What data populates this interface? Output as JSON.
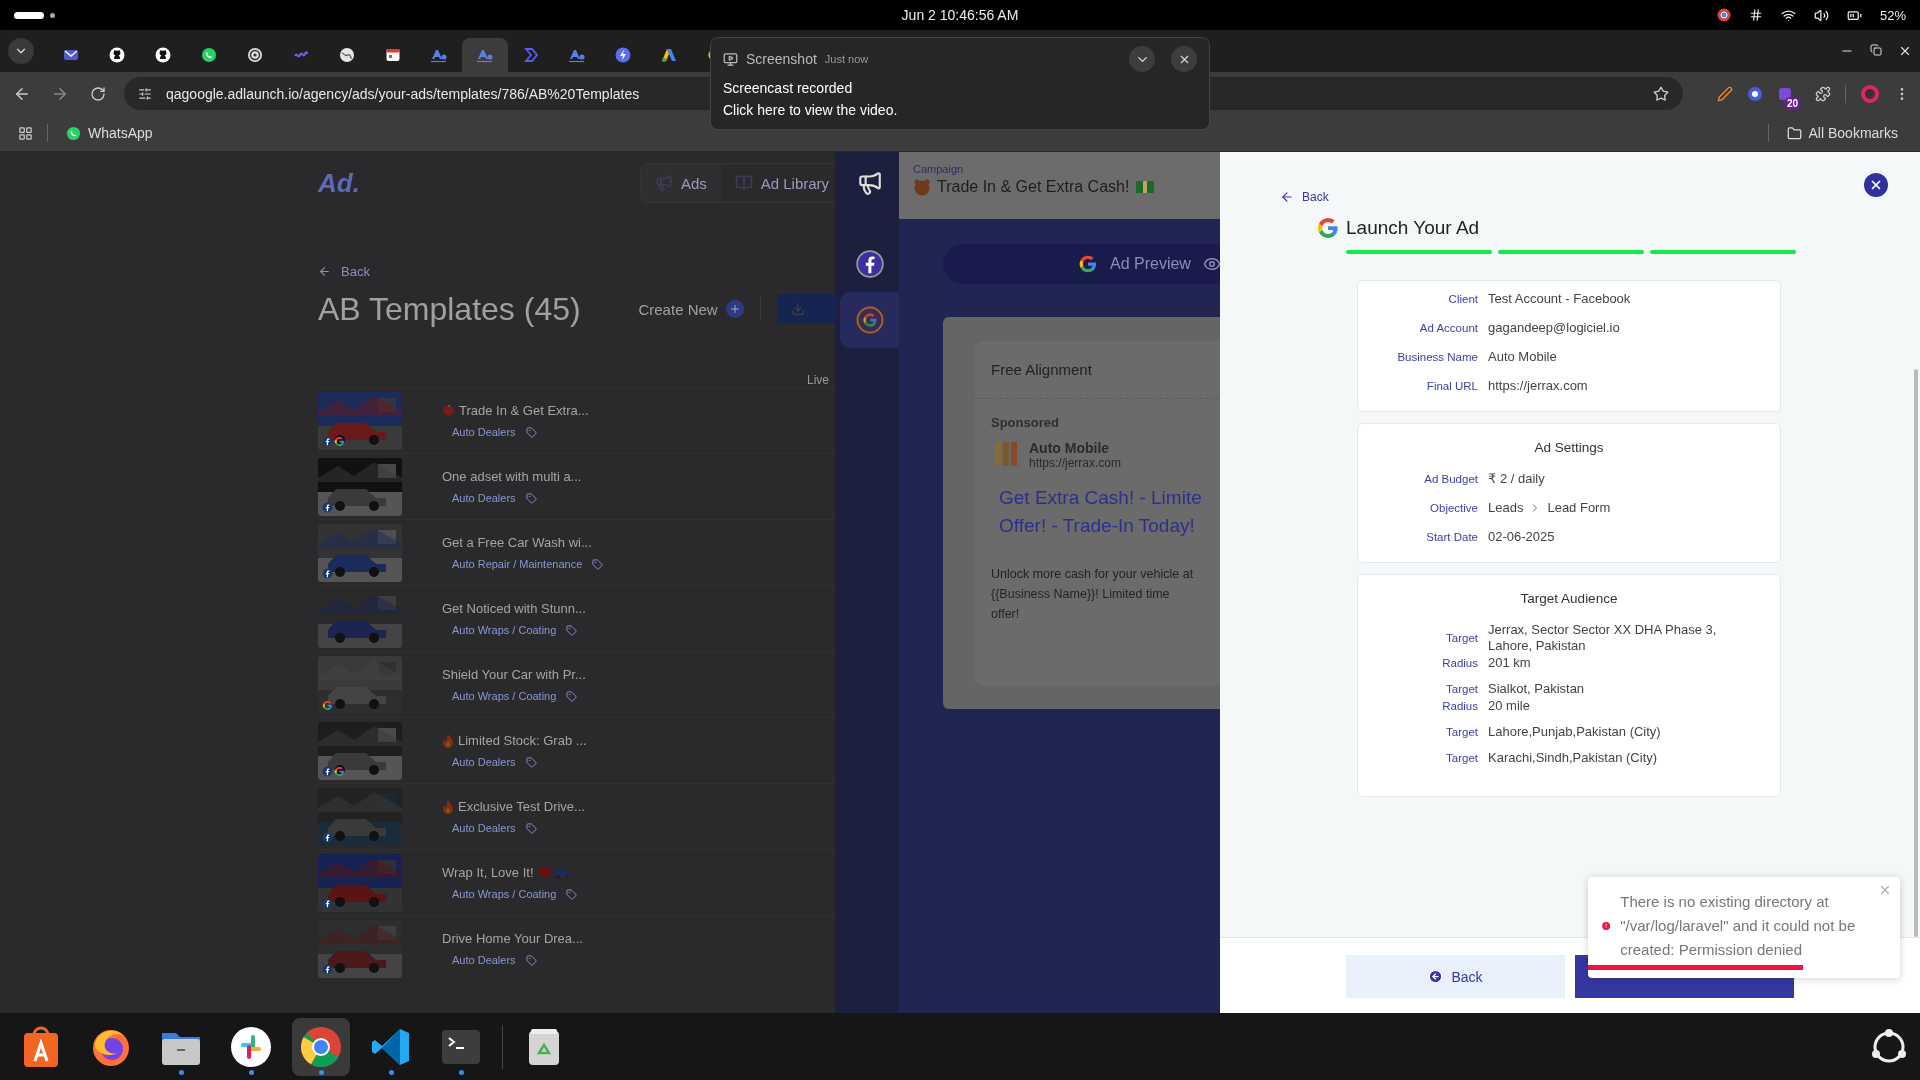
{
  "system_bar": {
    "date_time": "Jun 2  10:46:56 AM",
    "battery": "52%"
  },
  "browser": {
    "tabs": [
      {
        "kind": "mail",
        "selected": false
      },
      {
        "kind": "github",
        "selected": false
      },
      {
        "kind": "github",
        "selected": false
      },
      {
        "kind": "chat",
        "selected": false
      },
      {
        "kind": "ring",
        "selected": false
      },
      {
        "kind": "pen",
        "selected": false
      },
      {
        "kind": "globe",
        "selected": false
      },
      {
        "kind": "calendar",
        "selected": false
      },
      {
        "kind": "ad",
        "selected": false
      },
      {
        "kind": "ad",
        "selected": true
      },
      {
        "kind": "chevron",
        "selected": false
      },
      {
        "kind": "ad",
        "selected": false
      },
      {
        "kind": "bolt",
        "selected": false
      },
      {
        "kind": "triangle",
        "selected": false
      },
      {
        "kind": "google",
        "selected": false
      }
    ],
    "url": "qagoogle.adlaunch.io/agency/ads/your-ads/templates/786/AB%20Templates",
    "extension_badge": "20",
    "bookmarks": [
      {
        "label": "WhatsApp"
      }
    ],
    "all_bookmarks": "All Bookmarks"
  },
  "notification": {
    "app": "Screenshot",
    "time": "Just now",
    "title": "Screencast recorded",
    "body": "Click here to view the video."
  },
  "app": {
    "nav": [
      {
        "label": "Ads",
        "kind": "megaphone"
      },
      {
        "label": "Ad Library",
        "kind": "book"
      }
    ],
    "logo": "Ad.",
    "back": "Back",
    "title": "AB Templates (45)",
    "create_new": "Create New",
    "column_label": "Live",
    "templates": [
      {
        "kind": "apple",
        "title": "Trade In & Get Extra...",
        "category": "Auto Dealers",
        "facebook": true,
        "google": true
      },
      {
        "kind": "plain",
        "title": "One adset with multi a...",
        "category": "Auto Dealers",
        "facebook": true,
        "google": false
      },
      {
        "kind": "plain",
        "title": "Get a Free Car Wash wi...",
        "category": "Auto Repair / Maintenance",
        "facebook": true,
        "google": false
      },
      {
        "kind": "plain",
        "title": "Get Noticed with Stunn...",
        "category": "Auto Wraps / Coating",
        "facebook": false,
        "google": false
      },
      {
        "kind": "plain",
        "title": "Shield Your Car with Pr...",
        "category": "Auto Wraps / Coating",
        "facebook": false,
        "google": true
      },
      {
        "kind": "fire",
        "title": "Limited Stock: Grab ...",
        "category": "Auto Dealers",
        "facebook": true,
        "google": true
      },
      {
        "kind": "fire",
        "title": "Exclusive Test Drive...",
        "category": "Auto Dealers",
        "facebook": true,
        "google": false
      },
      {
        "kind": "heart_car",
        "title": "Wrap It, Love It!",
        "category": "Auto Wraps / Coating",
        "facebook": true,
        "google": false
      },
      {
        "kind": "plain",
        "title": "Drive Home Your Drea...",
        "category": "Auto Dealers",
        "facebook": true,
        "google": false
      }
    ]
  },
  "rail": [
    {
      "kind": "megaphone",
      "selected": false
    },
    {
      "kind": "facebook",
      "selected": false
    },
    {
      "kind": "google",
      "selected": true
    }
  ],
  "campaign": {
    "label": "Campaign",
    "name": "Trade In & Get Extra Cash!"
  },
  "preview": {
    "button": "Ad Preview",
    "headline": "Free Alignment",
    "sponsored": "Sponsored",
    "advertiser": "Auto Mobile",
    "url": "https://jerrax.com",
    "ad_title": [
      "Get Extra Cash! - Limite",
      "Offer! - Trade-In Today!"
    ],
    "description": "Unlock more cash for your vehicle at {{Business Name}}! Limited time offer!"
  },
  "launch": {
    "back": "Back",
    "title": "Launch Your Ad",
    "steps": [
      {
        "done": true
      },
      {
        "done": true
      },
      {
        "done": true
      }
    ],
    "account": [
      {
        "label": "Client",
        "value": "Test Account - Facebook"
      },
      {
        "label": "Ad Account",
        "value": "gagandeep@logiciel.io"
      },
      {
        "label": "Business Name",
        "value": "Auto Mobile"
      },
      {
        "label": "Final URL",
        "value": "https://jerrax.com"
      }
    ],
    "settings": {
      "title": "Ad Settings",
      "rows": [
        {
          "label": "Ad Budget",
          "value": "₹ 2 / daily"
        },
        {
          "label": "Objective",
          "path": [
            "Leads",
            "Lead Form"
          ]
        },
        {
          "label": "Start Date",
          "value": "02-06-2025"
        }
      ]
    },
    "audience": {
      "title": "Target Audience",
      "targets": [
        {
          "label": "Target",
          "value": "Jerrax, Sector Sector XX DHA Phase 3, Lahore, Pakistan",
          "radius_label": "Radius",
          "radius": "201 km"
        },
        {
          "label": "Target",
          "value": "Sialkot, Pakistan",
          "radius_label": "Radius",
          "radius": "20 mile"
        },
        {
          "label": "Target",
          "value": "Lahore,Punjab,Pakistan (City)"
        },
        {
          "label": "Target",
          "value": "Karachi,Sindh,Pakistan (City)"
        }
      ]
    },
    "back_button": "Back"
  },
  "toast": {
    "message": "There is no existing directory at \"/var/log/laravel\" and it could not be created: Permission denied",
    "level": 0.69
  },
  "taskbar": [
    {
      "kind": "store",
      "running": false,
      "selected": false
    },
    {
      "kind": "firefox",
      "running": false,
      "selected": false
    },
    {
      "kind": "files",
      "running": true,
      "selected": false
    },
    {
      "kind": "slack",
      "running": true,
      "selected": false
    },
    {
      "kind": "chrome",
      "running": true,
      "selected": true
    },
    {
      "kind": "code",
      "running": true,
      "selected": false
    },
    {
      "kind": "terminal",
      "running": true,
      "selected": false
    },
    {
      "kind": "trash",
      "running": false,
      "selected": false
    }
  ]
}
